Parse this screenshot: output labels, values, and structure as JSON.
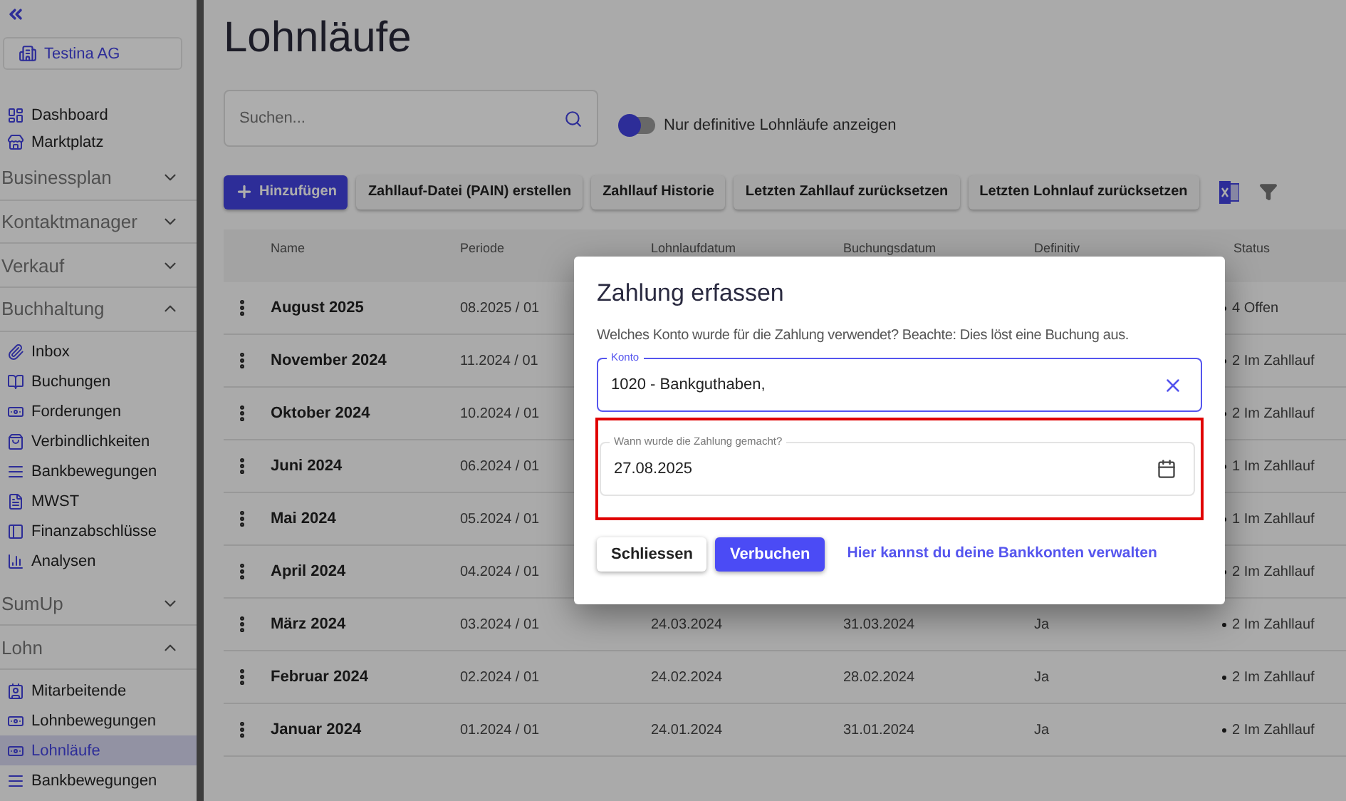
{
  "sidebar": {
    "company": "Testina AG",
    "nav": [
      {
        "kind": "link",
        "label": "Dashboard",
        "selected": false
      },
      {
        "kind": "link",
        "label": "Marktplatz",
        "selected": false
      },
      {
        "kind": "section",
        "label": "Businessplan",
        "expanded": false
      },
      {
        "kind": "section",
        "label": "Kontaktmanager",
        "expanded": false
      },
      {
        "kind": "section",
        "label": "Verkauf",
        "expanded": false
      },
      {
        "kind": "section",
        "label": "Buchhaltung",
        "expanded": true,
        "children": [
          {
            "label": "Inbox",
            "selected": false
          },
          {
            "label": "Buchungen",
            "selected": false
          },
          {
            "label": "Forderungen",
            "selected": false
          },
          {
            "label": "Verbindlichkeiten",
            "selected": false
          },
          {
            "label": "Bankbewegungen",
            "selected": false
          },
          {
            "label": "MWST",
            "selected": false
          },
          {
            "label": "Finanzabschlüsse",
            "selected": false
          },
          {
            "label": "Analysen",
            "selected": false
          }
        ]
      },
      {
        "kind": "section",
        "label": "SumUp",
        "expanded": false
      },
      {
        "kind": "section",
        "label": "Lohn",
        "expanded": true,
        "children": [
          {
            "label": "Mitarbeitende",
            "selected": false
          },
          {
            "label": "Lohnbewegungen",
            "selected": false
          },
          {
            "label": "Lohnläufe",
            "selected": true
          },
          {
            "label": "Bankbewegungen",
            "selected": false
          }
        ]
      }
    ]
  },
  "page": {
    "title": "Lohnläufe"
  },
  "search": {
    "placeholder": "Suchen..."
  },
  "filter_toggle": {
    "label": "Nur definitive Lohnläufe anzeigen",
    "on": false
  },
  "toolbar": {
    "buttons": [
      {
        "kind": "primary",
        "label": "Hinzufügen"
      },
      {
        "kind": "secondary",
        "label": "Zahllauf-Datei (PAIN) erstellen"
      },
      {
        "kind": "secondary",
        "label": "Zahllauf Historie"
      },
      {
        "kind": "secondary",
        "label": "Letzten Zahllauf zurücksetzen"
      },
      {
        "kind": "secondary",
        "label": "Letzten Lohnlauf zurücksetzen"
      }
    ]
  },
  "table": {
    "columns": [
      "Name",
      "Periode",
      "Lohnlaufdatum",
      "Buchungsdatum",
      "Definitiv",
      "Status"
    ],
    "rows": [
      {
        "name": "August 2025",
        "period": "08.2025 / 01",
        "status": "4 Offen"
      },
      {
        "name": "November 2024",
        "period": "11.2024 / 01",
        "status": "2 Im Zahllauf"
      },
      {
        "name": "Oktober 2024",
        "period": "10.2024 / 01",
        "status": "2 Im Zahllauf"
      },
      {
        "name": "Juni 2024",
        "period": "06.2024 / 01",
        "status": "1 Im Zahllauf"
      },
      {
        "name": "Mai 2024",
        "period": "05.2024 / 01",
        "status": "1 Im Zahllauf"
      },
      {
        "name": "April 2024",
        "period": "04.2024 / 01",
        "status": "2 Im Zahllauf"
      },
      {
        "name": "März 2024",
        "period": "03.2024 / 01",
        "run_date": "24.03.2024",
        "booking_date": "31.03.2024",
        "definitive": "Ja",
        "status": "2 Im Zahllauf"
      },
      {
        "name": "Februar 2024",
        "period": "02.2024 / 01",
        "run_date": "24.02.2024",
        "booking_date": "28.02.2024",
        "definitive": "Ja",
        "status": "2 Im Zahllauf"
      },
      {
        "name": "Januar 2024",
        "period": "01.2024 / 01",
        "run_date": "24.01.2024",
        "booking_date": "31.01.2024",
        "definitive": "Ja",
        "status": "2 Im Zahllauf"
      }
    ]
  },
  "dialog": {
    "title": "Zahlung erfassen",
    "text": "Welches Konto wurde für die Zahlung verwendet? Beachte: Dies löst eine Buchung aus.",
    "account_field": {
      "label": "Konto",
      "value": "1020 - Bankguthaben,"
    },
    "date_field": {
      "label": "Wann wurde die Zahlung gemacht?",
      "value": "27.08.2025"
    },
    "buttons": [
      {
        "kind": "secondary",
        "label": "Schliessen"
      },
      {
        "kind": "primary",
        "label": "Verbuchen"
      }
    ],
    "link": "Hier kannst du deine Bankkonten verwalten"
  }
}
